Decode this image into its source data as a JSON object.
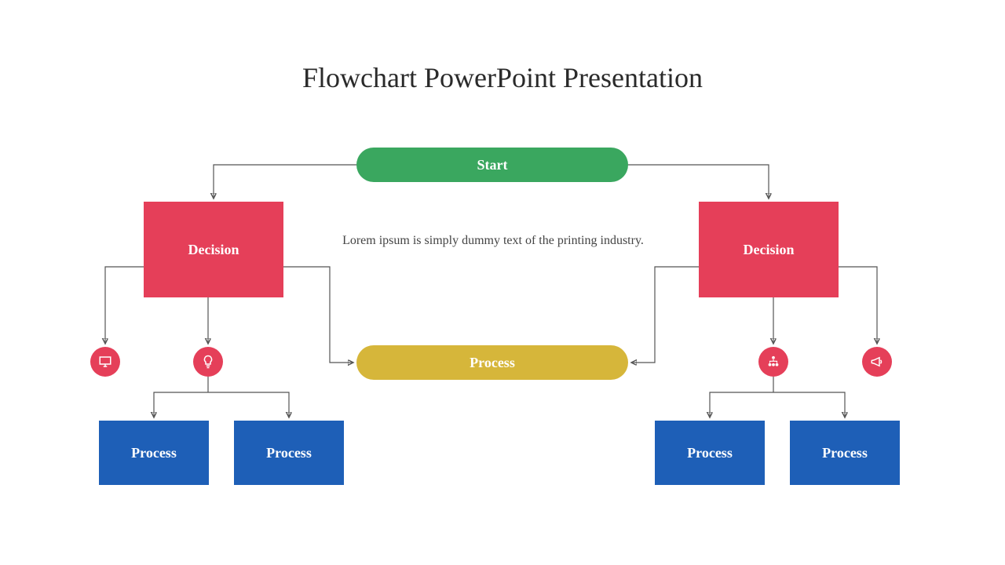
{
  "title": "Flowchart PowerPoint Presentation",
  "lorem": "Lorem ipsum is simply dummy text of the printing industry.",
  "nodes": {
    "start": "Start",
    "decision_left": "Decision",
    "decision_right": "Decision",
    "center_process": "Process",
    "blue1": "Process",
    "blue2": "Process",
    "blue3": "Process",
    "blue4": "Process"
  },
  "icons": {
    "circle1": "presentation-icon",
    "circle2": "lightbulb-icon",
    "circle3": "hierarchy-icon",
    "circle4": "megaphone-icon"
  },
  "colors": {
    "start": "#3aa75f",
    "decision": "#e53f59",
    "process_center": "#d6b63a",
    "process_box": "#1e5fb7",
    "circle": "#e53f59"
  }
}
